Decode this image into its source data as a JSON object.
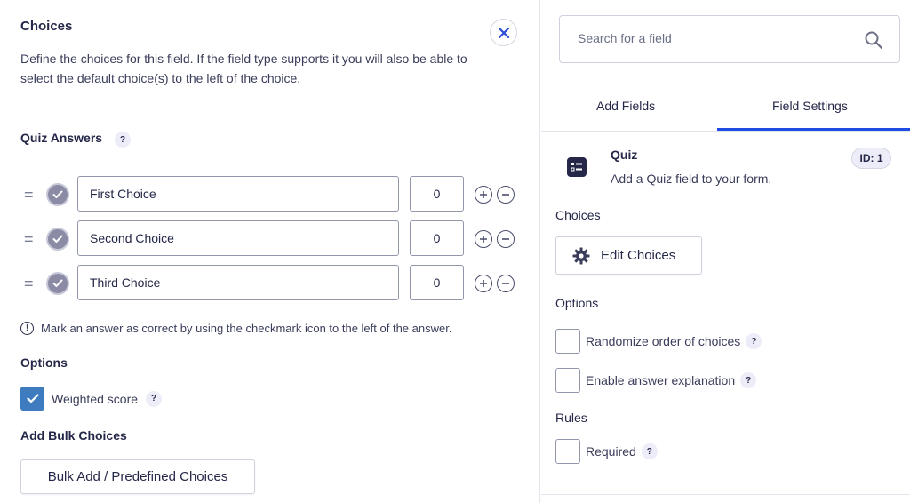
{
  "choices_panel": {
    "title": "Choices",
    "description": "Define the choices for this field. If the field type supports it you will also be able to select the default choice(s) to the left of the choice.",
    "quiz_answers_label": "Quiz Answers",
    "help_glyph": "?",
    "drag_glyph": "=",
    "rows": [
      {
        "label": "First Choice",
        "score": "0"
      },
      {
        "label": "Second Choice",
        "score": "0"
      },
      {
        "label": "Third Choice",
        "score": "0"
      }
    ],
    "note": "Mark an answer as correct by using the checkmark icon to the left of the answer.",
    "options_label": "Options",
    "weighted_score_label": "Weighted score",
    "weighted_score_checked": true,
    "bulk_label": "Add Bulk Choices",
    "bulk_button": "Bulk Add / Predefined Choices"
  },
  "sidebar": {
    "search_placeholder": "Search for a field",
    "tabs": [
      "Add Fields",
      "Field Settings"
    ],
    "active_tab": "Field Settings",
    "field": {
      "title": "Quiz",
      "description": "Add a Quiz field to your form.",
      "id_badge": "ID: 1"
    },
    "choices_label": "Choices",
    "edit_choices_button": "Edit Choices",
    "options_label": "Options",
    "options": [
      {
        "label": "Randomize order of choices",
        "checked": false
      },
      {
        "label": "Enable answer explanation",
        "checked": false
      }
    ],
    "rules_label": "Rules",
    "rules": [
      {
        "label": "Required",
        "checked": false
      }
    ]
  },
  "colors": {
    "accent": "#204ce5",
    "checkbox_checked": "#3e7cbf",
    "text": "#242748"
  }
}
